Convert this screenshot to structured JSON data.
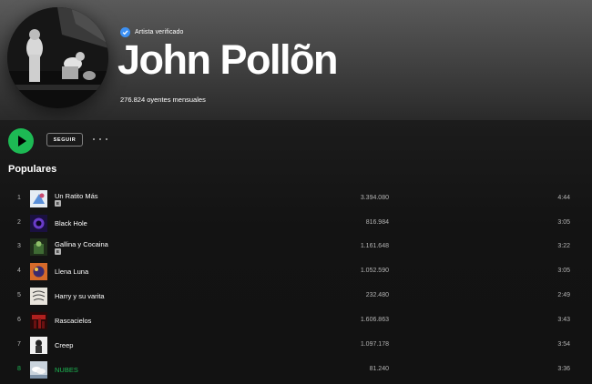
{
  "header": {
    "verified_label": "Artista verificado",
    "artist_name": "John Pollõn",
    "monthly_listeners": "276.824 oyentes mensuales"
  },
  "actions": {
    "follow_label": "SEGUIR",
    "more_icon": "more-options-icon",
    "play_icon": "play-icon"
  },
  "section": {
    "title": "Populares"
  },
  "tracks": [
    {
      "num": "1",
      "title": "Un Ratito Más",
      "plays": "3.394.080",
      "duration": "4:44",
      "explicit": "E"
    },
    {
      "num": "2",
      "title": "Black Hole",
      "plays": "816.984",
      "duration": "3:05"
    },
    {
      "num": "3",
      "title": "Gallina y Cocaina",
      "plays": "1.161.648",
      "duration": "3:22",
      "explicit": "E"
    },
    {
      "num": "4",
      "title": "Llena Luna",
      "plays": "1.052.590",
      "duration": "3:05"
    },
    {
      "num": "5",
      "title": "Harry y su varita",
      "plays": "232.480",
      "duration": "2:49"
    },
    {
      "num": "6",
      "title": "Rascacielos",
      "plays": "1.606.863",
      "duration": "3:43"
    },
    {
      "num": "7",
      "title": "Creep",
      "plays": "1.097.178",
      "duration": "3:54"
    },
    {
      "num": "8",
      "title": "NUBES",
      "plays": "81.240",
      "duration": "3:36"
    }
  ],
  "colors": {
    "accent": "#1db954",
    "background": "#121212",
    "text_secondary": "#b3b3b3"
  }
}
